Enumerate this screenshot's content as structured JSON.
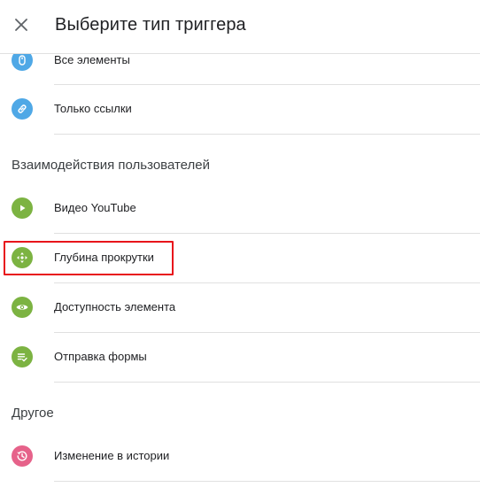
{
  "header": {
    "title": "Выберите тип триггера",
    "close_icon": "close-icon"
  },
  "items_top": [
    {
      "label": "Все элементы",
      "icon": "mouse-icon",
      "color": "#4fa8e6"
    },
    {
      "label": "Только ссылки",
      "icon": "link-icon",
      "color": "#4fa8e6"
    }
  ],
  "sections": [
    {
      "title": "Взаимодействия пользователей"
    },
    {
      "title": "Другое"
    }
  ],
  "items_user": [
    {
      "label": "Видео YouTube",
      "icon": "play-icon",
      "color": "#7cb342"
    },
    {
      "label": "Глубина прокрутки",
      "icon": "scroll-arrows-icon",
      "color": "#7cb342",
      "highlighted": true
    },
    {
      "label": "Доступность элемента",
      "icon": "eye-icon",
      "color": "#7cb342"
    },
    {
      "label": "Отправка формы",
      "icon": "form-submit-icon",
      "color": "#7cb342"
    }
  ],
  "items_other": [
    {
      "label": "Изменение в истории",
      "icon": "history-icon",
      "color": "#e6628a"
    }
  ],
  "colors": {
    "highlight_border": "#e8141b",
    "divider": "#e0e0e0",
    "web_icon": "#4fa8e6",
    "user_icon": "#7cb342",
    "other_icon": "#e6628a"
  }
}
